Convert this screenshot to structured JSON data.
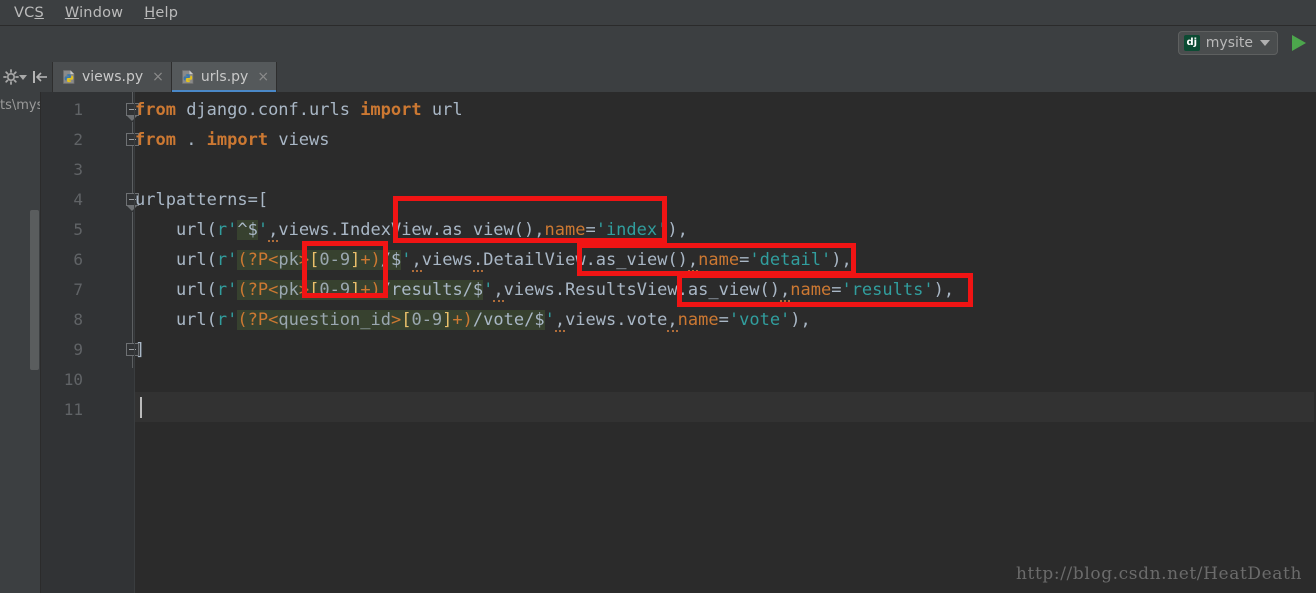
{
  "window": {
    "app": "PyCharm",
    "theme_bg": "#3c3f41",
    "editor_bg": "#2b2b2b",
    "accent": "#4a88c7",
    "annotation_color": "#f01414"
  },
  "menubar": {
    "items": [
      {
        "label": "VCS",
        "mnemonic": "S"
      },
      {
        "label": "Window",
        "mnemonic": "W"
      },
      {
        "label": "Help",
        "mnemonic": "H"
      }
    ]
  },
  "toolbar": {
    "run_config": {
      "icon_text": "dj",
      "icon_name": "django-icon",
      "label": "mysite",
      "dropdown_icon": "chevron-down-icon"
    },
    "run_button_icon": "run-play-icon"
  },
  "navstrip": {
    "gear_icon": "gear-icon",
    "gear_dropdown_icon": "chevron-down-icon",
    "collapse_icon": "collapse-all-icon",
    "breadcrumb_truncated": "ts\\mysi"
  },
  "tabs": [
    {
      "label": "views.py",
      "icon": "python-file-icon",
      "close_icon": "×",
      "active": false
    },
    {
      "label": "urls.py",
      "icon": "python-file-icon",
      "close_icon": "×",
      "active": true
    }
  ],
  "editor": {
    "line_numbers": [
      "1",
      "2",
      "3",
      "4",
      "5",
      "6",
      "7",
      "8",
      "9",
      "10",
      "11"
    ],
    "caret_line": 11,
    "lines": {
      "l1": "from django.conf.urls import url",
      "l2": "from . import views",
      "l3": "",
      "l4": "urlpatterns=[",
      "l5": "    url(r'^$',views.IndexView.as_view(),name='index'),",
      "l6": "    url(r'(?P<pk>[0-9]+)/$',views.DetailView.as_view(),name='detail'),",
      "l7": "    url(r'(?P<pk>[0-9]+)/results/$',views.ResultsView.as_view(),name='results'),",
      "l8": "    url(r'(?P<question_id>[0-9]+)/vote/$',views.vote,name='vote'),",
      "l9": "]",
      "l10": "",
      "l11": ""
    },
    "tokens": {
      "kw_from": "from",
      "kw_import": "import",
      "mod_django": " django.conf.urls ",
      "mod_url": " url",
      "dot": " . ",
      "mod_views": " views",
      "urlpatterns": "urlpatterns=[",
      "url_call_open": "url(",
      "r_prefix": "r",
      "quote": "'",
      "rx_index": "^$",
      "views_dot": ",views",
      "index_view": ".IndexView.as_view()",
      "comma": ",",
      "name_kw": "name",
      "eq": "=",
      "name_index": "'index'",
      "close_paren_comma": "),",
      "rx_group_open": "(?",
      "rx_named_p": "P<",
      "rx_pk": "pk",
      "rx_gt": ">",
      "rx_class_open": "[",
      "rx_digits": "0-9",
      "rx_class_close": "]",
      "rx_plus": "+",
      "rx_group_close": ")",
      "rx_slash_dollar": "/$",
      "rx_results": "/results/$",
      "rx_vote": "/vote/$",
      "rx_question_id": "question_id",
      "detail_view": "DetailView.as_view()",
      "results_view": ".ResultsView.as_view()",
      "vote_fn": ".vote",
      "name_detail": "'detail'",
      "name_results": "'results'",
      "name_vote": "'vote'",
      "bracket_close": "]"
    }
  },
  "annotations": [
    {
      "id": "box-indexview",
      "target": ".IndexView.as_view()"
    },
    {
      "id": "box-pk-groups",
      "target": "P<pk>["
    },
    {
      "id": "box-detailview",
      "target": "DetailView.as_view()"
    },
    {
      "id": "box-resultsview",
      "target": ".ResultsView.as_view()"
    }
  ],
  "watermark": {
    "text": "http://blog.csdn.net/HeatDeath"
  }
}
